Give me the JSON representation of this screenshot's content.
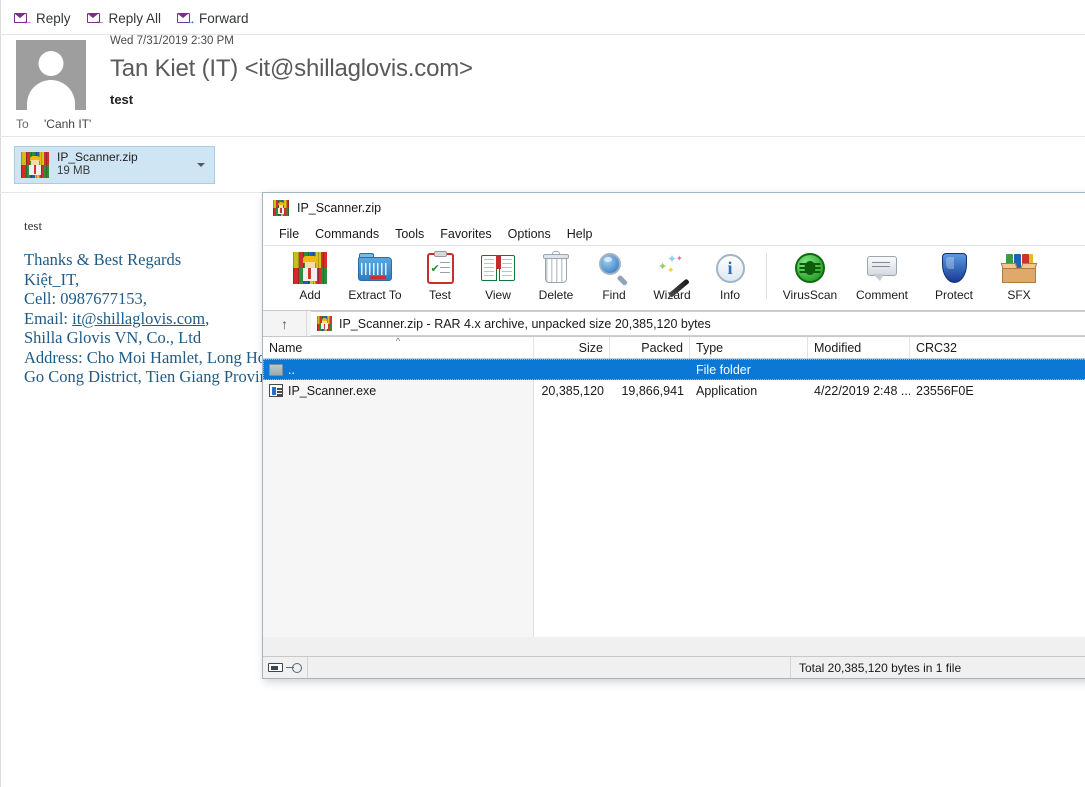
{
  "mail": {
    "toolbar": [
      {
        "label": "Reply",
        "icon": "reply-icon"
      },
      {
        "label": "Reply All",
        "icon": "reply-all-icon"
      },
      {
        "label": "Forward",
        "icon": "forward-icon"
      }
    ],
    "date": "Wed 7/31/2019 2:30 PM",
    "from": "Tan Kiet (IT) <it@shillaglovis.com>",
    "subject": "test",
    "to_label": "To",
    "to_value": "'Canh IT'",
    "attachment": {
      "name": "IP_Scanner.zip",
      "size": "19 MB",
      "icon": "winrar-zip-icon"
    },
    "body": {
      "greeting": "test",
      "signature": [
        "Thanks & Best Regards",
        "Kiệt_IT,",
        "Cell: 0987677153,",
        "Shilla Glovis VN, Co., Ltd",
        "Address: Cho Moi Hamlet, Long Hoa",
        "Go Cong District, Tien Giang Provin"
      ],
      "email_line_prefix": "Email: ",
      "email_link": "it@shillaglovis.com",
      "email_line_suffix": ","
    }
  },
  "winrar": {
    "title": "IP_Scanner.zip",
    "title_icon": "winrar-zip-icon",
    "menu": [
      "File",
      "Commands",
      "Tools",
      "Favorites",
      "Options",
      "Help"
    ],
    "toolbar": [
      {
        "label": "Add",
        "icon": "add-archive-icon"
      },
      {
        "label": "Extract To",
        "icon": "extract-to-folder-icon"
      },
      {
        "label": "Test",
        "icon": "test-clipboard-icon"
      },
      {
        "label": "View",
        "icon": "view-book-icon"
      },
      {
        "label": "Delete",
        "icon": "delete-trash-icon"
      },
      {
        "label": "Find",
        "icon": "find-magnifier-icon"
      },
      {
        "label": "Wizard",
        "icon": "wizard-wand-icon"
      },
      {
        "label": "Info",
        "icon": "info-circle-icon"
      },
      {
        "label": "VirusScan",
        "icon": "virusscan-bug-icon"
      },
      {
        "label": "Comment",
        "icon": "comment-bubble-icon"
      },
      {
        "label": "Protect",
        "icon": "protect-shield-icon"
      },
      {
        "label": "SFX",
        "icon": "sfx-box-icon"
      }
    ],
    "pathbar": {
      "up_icon": "up-arrow-icon",
      "archive_icon": "winrar-zip-icon",
      "text": "IP_Scanner.zip - RAR 4.x archive, unpacked size 20,385,120 bytes"
    },
    "columns": [
      {
        "key": "name",
        "label": "Name",
        "align": "left",
        "sorted": true
      },
      {
        "key": "size",
        "label": "Size",
        "align": "right"
      },
      {
        "key": "packed",
        "label": "Packed",
        "align": "right"
      },
      {
        "key": "type",
        "label": "Type",
        "align": "left"
      },
      {
        "key": "modified",
        "label": "Modified",
        "align": "left"
      },
      {
        "key": "crc32",
        "label": "CRC32",
        "align": "left"
      }
    ],
    "rows": [
      {
        "name": "..",
        "icon": "folder-up-icon",
        "size": "",
        "packed": "",
        "type": "File folder",
        "modified": "",
        "crc32": "",
        "selected": true
      },
      {
        "name": "IP_Scanner.exe",
        "icon": "application-exe-icon",
        "size": "20,385,120",
        "packed": "19,866,941",
        "type": "Application",
        "modified": "4/22/2019 2:48 ...",
        "crc32": "23556F0E",
        "selected": false
      }
    ],
    "status": {
      "disk_icon": "disk-icon",
      "key_icon": "key-icon",
      "total": "Total 20,385,120 bytes in 1 file"
    }
  },
  "colors": {
    "selection_blue": "#0a78d4",
    "attachment_chip": "#cfe5f3",
    "signature_text": "#1f5b87",
    "window_border": "#9fb6c6"
  }
}
